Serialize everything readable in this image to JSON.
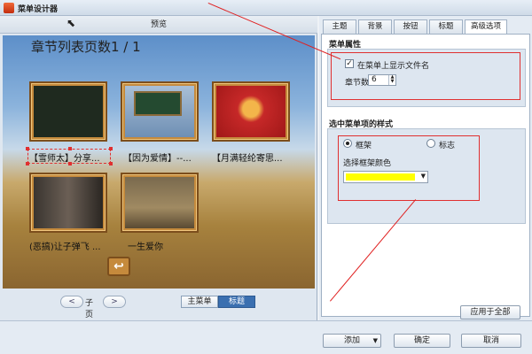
{
  "window": {
    "title": "菜单设计器"
  },
  "preview": {
    "header": "预览",
    "chapter_title": "章节列表页数1 / 1",
    "thumbnails": [
      {
        "caption": "【雪师太】分享..."
      },
      {
        "caption": "【因为爱情】--..."
      },
      {
        "caption": "【月满轻纶寄思..."
      },
      {
        "caption": "(恶搞)让子弹飞 ..."
      },
      {
        "caption": "一生爱你"
      }
    ],
    "pager": {
      "prev": "<",
      "label": "子页",
      "next": ">"
    },
    "mode_tabs": [
      "主菜单",
      "标题"
    ],
    "active_mode": "标题"
  },
  "settings": {
    "tabs": [
      "主题",
      "背景",
      "按钮",
      "标题",
      "高级选项"
    ],
    "active_tab": "高级选项",
    "menu_props": {
      "title": "菜单属性",
      "show_filename_label": "在菜单上显示文件名",
      "show_filename_checked": true,
      "chapter_count_label": "章节数",
      "chapter_count_value": "6"
    },
    "style": {
      "title": "选中菜单项的样式",
      "frame_label": "框架",
      "mark_label": "标志",
      "selected": "框架",
      "color_label": "选择框架颜色",
      "color_value": "#ffff00"
    },
    "apply_all": "应用于全部"
  },
  "footer": {
    "add_label": "添加",
    "ok_label": "确定",
    "cancel_label": "取消"
  }
}
